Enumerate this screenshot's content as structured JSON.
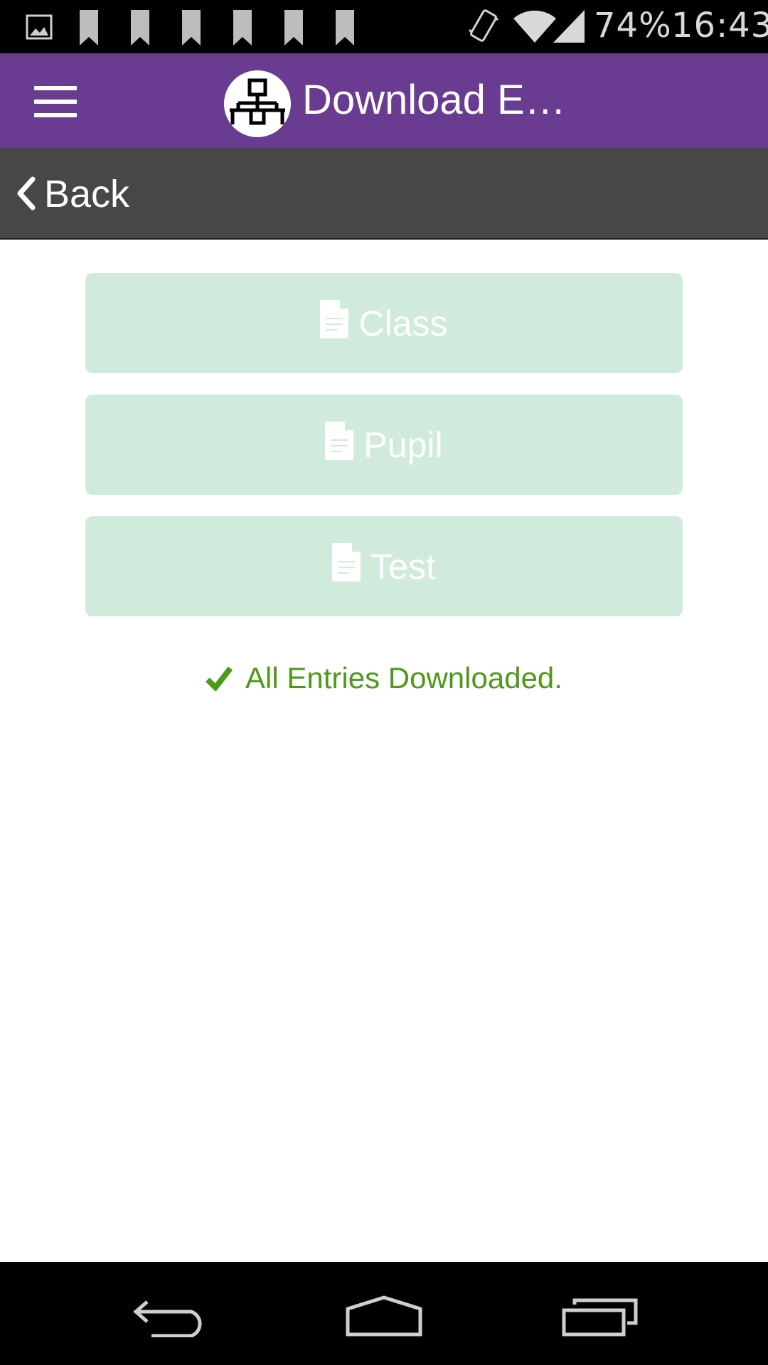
{
  "status_bar": {
    "battery": "74%",
    "time": "16:43",
    "icons": [
      "gallery-icon",
      "bookmark-icon",
      "bookmark-icon",
      "bookmark-icon",
      "bookmark-icon",
      "bookmark-icon",
      "bookmark-icon",
      "vibrate-icon",
      "wifi-icon",
      "signal-icon"
    ]
  },
  "app_bar": {
    "title": "Download E…",
    "menu_icon": "hamburger-icon",
    "logo_icon": "network-hierarchy-icon",
    "color": "#693c91"
  },
  "back_bar": {
    "label": "Back",
    "icon": "chevron-left-icon"
  },
  "downloads": {
    "items": [
      {
        "label": "Class",
        "icon": "document-icon"
      },
      {
        "label": "Pupil",
        "icon": "document-icon"
      },
      {
        "label": "Test",
        "icon": "document-icon"
      }
    ],
    "button_color": "#d0eadb"
  },
  "status": {
    "message": "All Entries Downloaded.",
    "icon": "checkmark-icon",
    "color": "#4f9818"
  },
  "nav_bar": {
    "icons": [
      "back-nav-icon",
      "home-nav-icon",
      "recents-nav-icon"
    ]
  }
}
